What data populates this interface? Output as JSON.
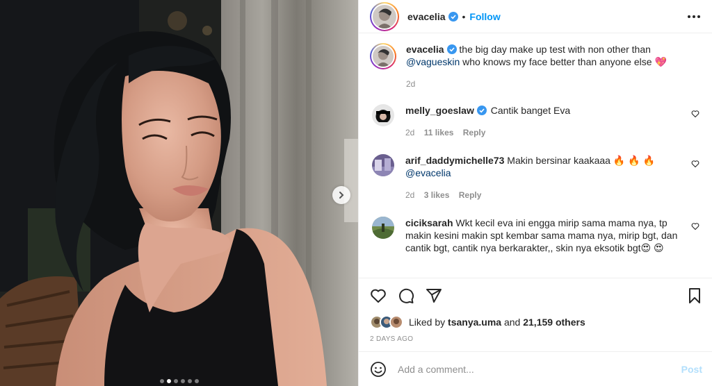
{
  "header": {
    "username": "evacelia",
    "separator": "•",
    "follow_label": "Follow",
    "more_icon": "more-horizontal-icon"
  },
  "caption": {
    "username": "evacelia",
    "text_before": "the big day make up test with non other than",
    "mention": "@vagueskin",
    "text_after": "who knows my face better than anyone else",
    "emoji": "💖",
    "time": "2d"
  },
  "comments": [
    {
      "username": "melly_goeslaw",
      "verified": true,
      "text": "Cantik banget Eva",
      "mention": "",
      "time": "2d",
      "likes": "11 likes",
      "reply": "Reply"
    },
    {
      "username": "arif_daddymichelle73",
      "verified": false,
      "text": "Makin bersinar kaakaaa 🔥 🔥 🔥",
      "mention": "@evacelia",
      "time": "2d",
      "likes": "3 likes",
      "reply": "Reply"
    },
    {
      "username": "ciciksarah",
      "verified": false,
      "text": "Wkt kecil eva ini engga mirip sama mama nya, tp makin kesini makin spt kembar sama mama nya, mirip bgt, dan cantik bgt, cantik nya berkarakter,, skin nya eksotik bgt😍 😍",
      "mention": "",
      "time": "",
      "likes": "",
      "reply": ""
    }
  ],
  "likes": {
    "prefix": "Liked by",
    "user": "tsanya.uma",
    "and": "and",
    "others": "21,159 others"
  },
  "date": "2 DAYS AGO",
  "add_comment": {
    "placeholder": "Add a comment...",
    "post_label": "Post"
  },
  "carousel": {
    "count": 6,
    "active": 1
  },
  "colors": {
    "accent": "#0095f6",
    "verified": "#3897f0",
    "post_disabled": "#b2dffc"
  }
}
